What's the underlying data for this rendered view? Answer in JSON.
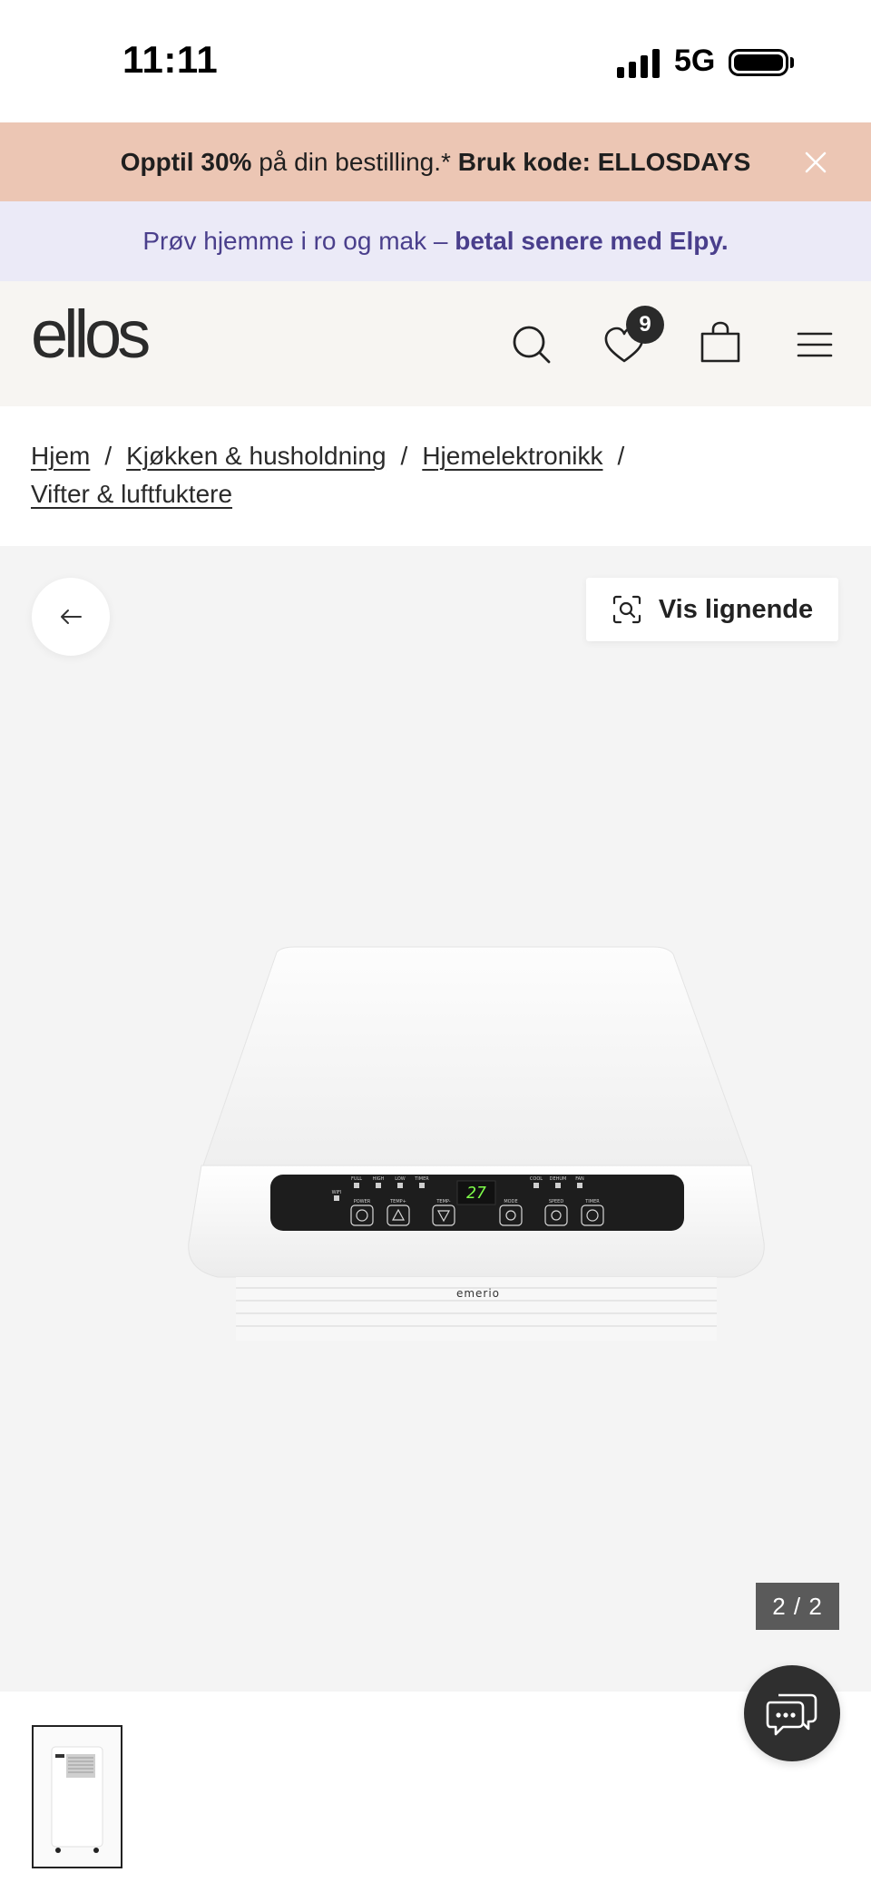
{
  "status_bar": {
    "time": "11:11",
    "network": "5G"
  },
  "promo": {
    "part1": "Opptil 30%",
    "part2": " på din bestilling.* ",
    "part3": "Bruk kode: ELLOSDAYS"
  },
  "elpy": {
    "part1": "Prøv hjemme i ro og mak – ",
    "part2": "betal senere med Elpy."
  },
  "header": {
    "logo": "ellos",
    "wishlist_count": "9",
    "icons": [
      "search-icon",
      "heart-icon",
      "bag-icon",
      "menu-icon"
    ]
  },
  "breadcrumb": {
    "items": [
      "Hjem",
      "Kjøkken & husholdning",
      "Hjemelektronikk",
      "Vifter & luftfuktere"
    ],
    "separator": "/"
  },
  "gallery": {
    "similar_label": "Vis lignende",
    "counter": "2 / 2",
    "product": {
      "display_temp": "27",
      "brand": "emerio",
      "indicator_labels": [
        "FULL",
        "HIGH",
        "LOW",
        "TIMER",
        "COOL",
        "DEHUM",
        "FAN"
      ],
      "wifi_label": "WIFI",
      "button_labels": [
        "POWER",
        "TEMP+",
        "TEMP-",
        "MODE",
        "SPEED",
        "TIMER"
      ]
    }
  },
  "colors": {
    "promo_bg": "#ecc6b4",
    "elpy_bg": "#ebeaf7",
    "elpy_text": "#4a3f8c",
    "header_bg": "#f7f5f2",
    "gallery_bg": "#f4f4f4"
  }
}
